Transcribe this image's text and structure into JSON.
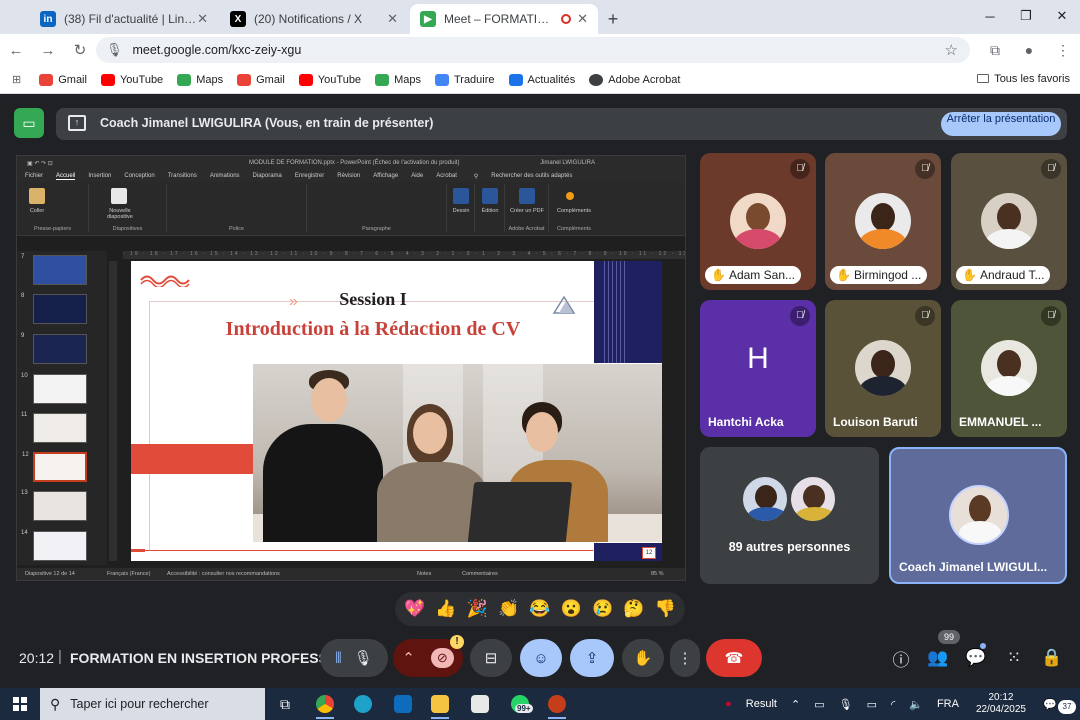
{
  "browser": {
    "tabs": [
      {
        "title": "(38) Fil d'actualité | LinkedIn",
        "favicon": "linkedin-icon",
        "color": "#0a66c2"
      },
      {
        "title": "(20) Notifications / X",
        "favicon": "x-icon",
        "color": "#000000"
      },
      {
        "title": "Meet – FORMATION EN INS",
        "favicon": "meet-icon",
        "color": "#34a853"
      }
    ],
    "url": "meet.google.com/kxc-zeiy-xgu",
    "bookmarks": [
      "Gmail",
      "YouTube",
      "Maps",
      "Gmail",
      "YouTube",
      "Maps",
      "Traduire",
      "Actualités",
      "Adobe Acrobat"
    ],
    "all_bookmarks": "Tous les favoris"
  },
  "meet": {
    "presenting_label": "Coach Jimanel LWIGULIRA (Vous, en train de présenter)",
    "stop_presenting": "Arrêter la présentation",
    "participants": [
      {
        "name": "Adam San...",
        "hand": true,
        "muted": true,
        "bg": "#6b3a2a"
      },
      {
        "name": "Birmingod ...",
        "hand": true,
        "muted": true,
        "bg": "#6a4a3a"
      },
      {
        "name": "Andraud T...",
        "hand": true,
        "muted": true,
        "bg": "#5a5040"
      },
      {
        "name": "Hantchi Acka",
        "hand": false,
        "muted": true,
        "bg": "#5b2fa8",
        "initial": "H"
      },
      {
        "name": "Louison Baruti",
        "hand": false,
        "muted": true,
        "bg": "#5a5238"
      },
      {
        "name": "EMMANUEL ...",
        "hand": false,
        "muted": true,
        "bg": "#4e5538"
      }
    ],
    "others_label": "89 autres personnes",
    "self_name": "Coach Jimanel LWIGULI...",
    "reactions": [
      "💖",
      "👍",
      "🎉",
      "👏",
      "😂",
      "😮",
      "😢",
      "🤔",
      "👎"
    ],
    "clock": "20:12",
    "meeting_title": "FORMATION EN INSERTION PROFESS...",
    "people_count": "99"
  },
  "ppt": {
    "doc_title": "MODULE DE FORMATION.pptx  -  PowerPoint (Échec de l'activation du produit)",
    "search_placeholder": "Rechercher des outils adaptés",
    "user": "Jimanel LWIGULIRA",
    "menu": [
      "Fichier",
      "Accueil",
      "Insertion",
      "Conception",
      "Transitions",
      "Animations",
      "Diaporama",
      "Enregistrer",
      "Révision",
      "Affichage",
      "Aide",
      "Acrobat"
    ],
    "ribbon_groups": [
      "Presse-papiers",
      "Diapositives",
      "Police",
      "Paragraphe",
      "Adobe Acrobat",
      "Compléments"
    ],
    "ribbon_buttons": {
      "paste": "Coller",
      "new_slide": "Nouvelle diapositive",
      "design": "Dessin",
      "edit": "Édition",
      "create_pdf": "Créer un PDF",
      "addins": "Compléments"
    },
    "thumb_numbers": [
      "7",
      "8",
      "9",
      "10",
      "11",
      "12",
      "13",
      "14"
    ],
    "selected_slide": "12",
    "status": {
      "slide": "Diapositive 12 de 14",
      "lang": "Français (France)",
      "access": "Accessibilité : consulter nos recommandations",
      "notes": "Notes",
      "comments": "Commentaires",
      "zoom": "85 %"
    },
    "slide": {
      "title": "Session I",
      "subtitle": "Introduction à la Rédaction de CV",
      "number": "12"
    }
  },
  "taskbar": {
    "search_placeholder": "Taper ici pour rechercher",
    "whatsapp_badge": "99+",
    "weather": "Result",
    "lang": "FRA",
    "time": "20:12",
    "date": "22/04/2025",
    "notifications": "37"
  }
}
